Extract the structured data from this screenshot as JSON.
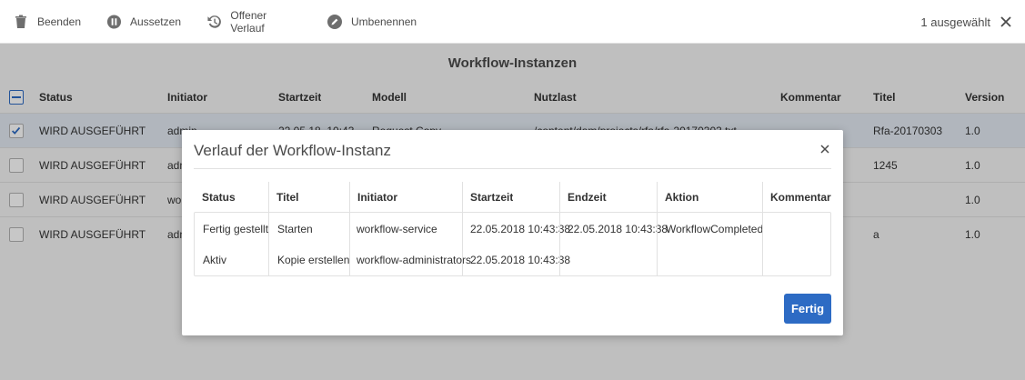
{
  "toolbar": {
    "items": [
      {
        "label": "Beenden",
        "icon": "trash-icon"
      },
      {
        "label": "Aussetzen",
        "icon": "pause-icon"
      },
      {
        "label": "Offener Verlauf",
        "icon": "history-icon"
      },
      {
        "label": "Umbenennen",
        "icon": "pencil-icon"
      }
    ],
    "selection_label": "1 ausgewählt"
  },
  "page": {
    "title": "Workflow-Instanzen",
    "columns": [
      "Status",
      "Initiator",
      "Startzeit",
      "Modell",
      "Nutzlast",
      "Kommentar",
      "Titel",
      "Version"
    ],
    "rows": [
      {
        "status": "WIRD AUSGEFÜHRT",
        "initiator": "admin",
        "startzeit": "22.05.18, 10:43",
        "modell": "Request Copy",
        "nutzlast": "/content/dam/projects/rfa/rfa-20170303.txt",
        "kommentar": "",
        "titel": "Rfa-20170303",
        "version": "1.0",
        "checked": true
      },
      {
        "status": "WIRD AUSGEFÜHRT",
        "initiator": "adm",
        "startzeit": "",
        "modell": "",
        "nutzlast": "",
        "kommentar": "",
        "titel": "1245",
        "version": "1.0",
        "checked": false
      },
      {
        "status": "WIRD AUSGEFÜHRT",
        "initiator": "wo",
        "startzeit": "",
        "modell": "",
        "nutzlast": "",
        "kommentar": "",
        "titel": "",
        "version": "1.0",
        "checked": false
      },
      {
        "status": "WIRD AUSGEFÜHRT",
        "initiator": "adm",
        "startzeit": "",
        "modell": "",
        "nutzlast": "",
        "kommentar": "",
        "titel": "a",
        "version": "1.0",
        "checked": false
      }
    ]
  },
  "dialog": {
    "title": "Verlauf der Workflow-Instanz",
    "columns": [
      "Status",
      "Titel",
      "Initiator",
      "Startzeit",
      "Endzeit",
      "Aktion",
      "Kommentar"
    ],
    "rows": [
      {
        "status": "Fertig gestellt",
        "titel": "Starten",
        "initiator": "workflow-service",
        "startzeit": "22.05.2018 10:43:38",
        "endzeit": "22.05.2018 10:43:38",
        "aktion": "WorkflowCompleted",
        "kommentar": ""
      },
      {
        "status": "Aktiv",
        "titel": "Kopie erstellen",
        "initiator": "workflow-administrators",
        "startzeit": "22.05.2018 10:43:38",
        "endzeit": "",
        "aktion": "",
        "kommentar": ""
      }
    ],
    "done_label": "Fertig"
  },
  "colors": {
    "accent": "#2d6bc4",
    "selected_row": "#e3eaf3",
    "overlay": "rgba(0,0,0,0.22)"
  }
}
